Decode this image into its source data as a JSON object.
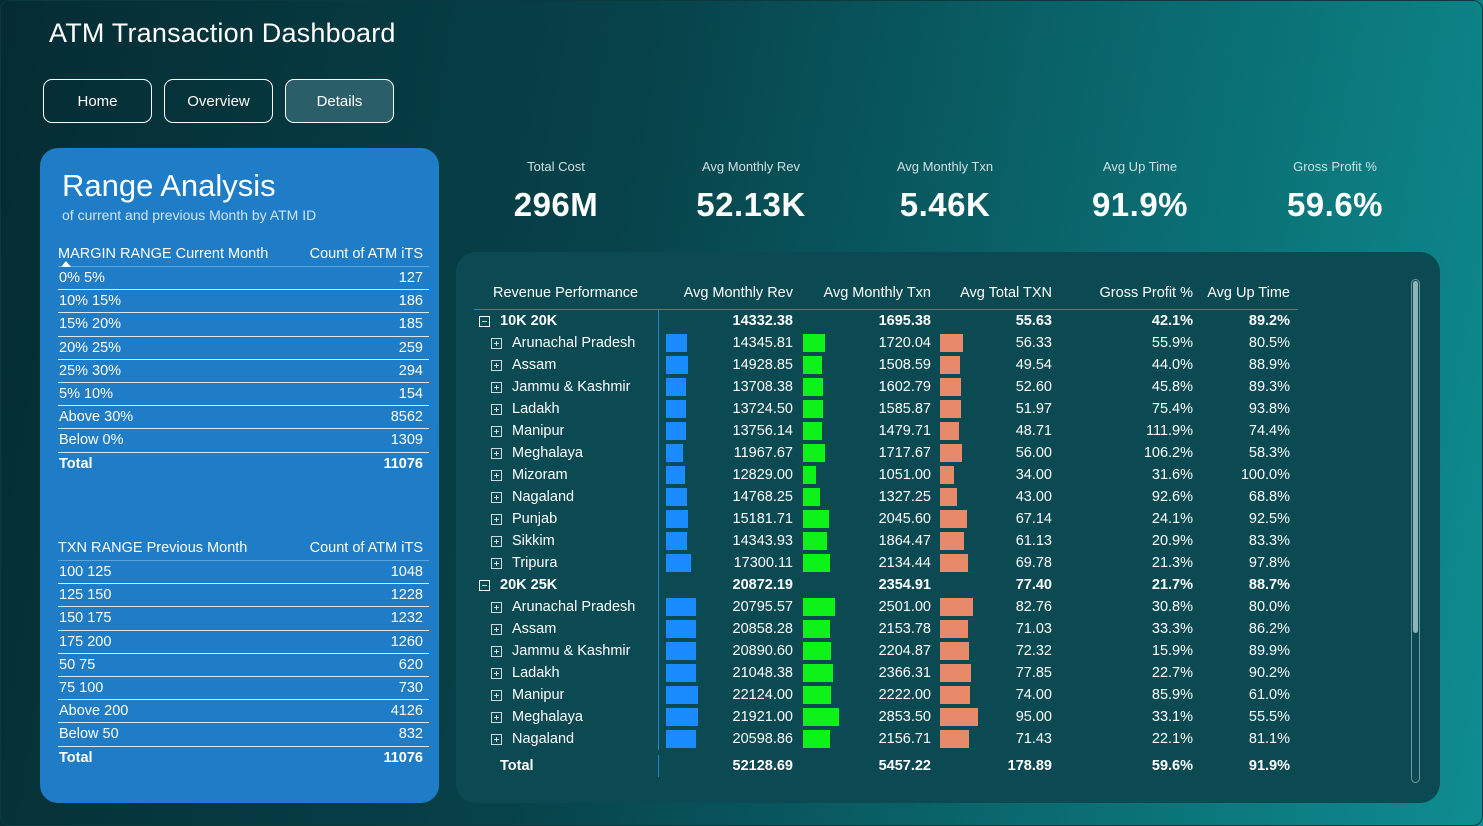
{
  "app": {
    "title": "ATM Transaction Dashboard"
  },
  "nav": [
    {
      "label": "Home",
      "active": false
    },
    {
      "label": "Overview",
      "active": false
    },
    {
      "label": "Details",
      "active": true
    }
  ],
  "range": {
    "title": "Range Analysis",
    "subtitle": "of current and previous Month by ATM ID",
    "margin": {
      "col1": "MARGIN RANGE Current Month",
      "col2": "Count of ATM iTS",
      "rows": [
        {
          "range": "0% 5%",
          "count": "127"
        },
        {
          "range": "10% 15%",
          "count": "186"
        },
        {
          "range": "15% 20%",
          "count": "185"
        },
        {
          "range": "20% 25%",
          "count": "259"
        },
        {
          "range": "25% 30%",
          "count": "294"
        },
        {
          "range": "5% 10%",
          "count": "154"
        },
        {
          "range": "Above 30%",
          "count": "8562"
        },
        {
          "range": "Below 0%",
          "count": "1309"
        }
      ],
      "total_label": "Total",
      "total": "11076"
    },
    "txn": {
      "col1": "TXN RANGE Previous Month",
      "col2": "Count of ATM iTS",
      "rows": [
        {
          "range": "100 125",
          "count": "1048"
        },
        {
          "range": "125 150",
          "count": "1228"
        },
        {
          "range": "150 175",
          "count": "1232"
        },
        {
          "range": "175 200",
          "count": "1260"
        },
        {
          "range": "50 75",
          "count": "620"
        },
        {
          "range": "75 100",
          "count": "730"
        },
        {
          "range": "Above 200",
          "count": "4126"
        },
        {
          "range": "Below 50",
          "count": "832"
        }
      ],
      "total_label": "Total",
      "total": "11076"
    }
  },
  "kpis": [
    {
      "label": "Total Cost",
      "value": "296M"
    },
    {
      "label": "Avg Monthly Rev",
      "value": "52.13K"
    },
    {
      "label": "Avg Monthly Txn",
      "value": "5.46K"
    },
    {
      "label": "Avg Up Time",
      "value": "91.9%"
    },
    {
      "label": "Gross Profit %",
      "value": "59.6%"
    }
  ],
  "matrix": {
    "headers": [
      "Revenue Performance",
      "Avg Monthly Rev",
      "Avg Monthly Txn",
      "Avg Total TXN",
      "Gross Profit %",
      "Avg Up Time"
    ],
    "bar_scale": {
      "rev_max": 22124.0,
      "txn_max": 2853.5,
      "tot_max": 95.0
    },
    "groups": [
      {
        "name": "10K 20K",
        "rev": "14332.38",
        "txn": "1695.38",
        "tot": "55.63",
        "gp": "42.1%",
        "up": "89.2%",
        "children": [
          {
            "name": "Arunachal Pradesh",
            "rev": "14345.81",
            "txn": "1720.04",
            "tot": "56.33",
            "gp": "55.9%",
            "up": "80.5%"
          },
          {
            "name": "Assam",
            "rev": "14928.85",
            "txn": "1508.59",
            "tot": "49.54",
            "gp": "44.0%",
            "up": "88.9%"
          },
          {
            "name": "Jammu & Kashmir",
            "rev": "13708.38",
            "txn": "1602.79",
            "tot": "52.60",
            "gp": "45.8%",
            "up": "89.3%"
          },
          {
            "name": "Ladakh",
            "rev": "13724.50",
            "txn": "1585.87",
            "tot": "51.97",
            "gp": "75.4%",
            "up": "93.8%"
          },
          {
            "name": "Manipur",
            "rev": "13756.14",
            "txn": "1479.71",
            "tot": "48.71",
            "gp": "111.9%",
            "up": "74.4%"
          },
          {
            "name": "Meghalaya",
            "rev": "11967.67",
            "txn": "1717.67",
            "tot": "56.00",
            "gp": "106.2%",
            "up": "58.3%"
          },
          {
            "name": "Mizoram",
            "rev": "12829.00",
            "txn": "1051.00",
            "tot": "34.00",
            "gp": "31.6%",
            "up": "100.0%"
          },
          {
            "name": "Nagaland",
            "rev": "14768.25",
            "txn": "1327.25",
            "tot": "43.00",
            "gp": "92.6%",
            "up": "68.8%"
          },
          {
            "name": "Punjab",
            "rev": "15181.71",
            "txn": "2045.60",
            "tot": "67.14",
            "gp": "24.1%",
            "up": "92.5%"
          },
          {
            "name": "Sikkim",
            "rev": "14343.93",
            "txn": "1864.47",
            "tot": "61.13",
            "gp": "20.9%",
            "up": "83.3%"
          },
          {
            "name": "Tripura",
            "rev": "17300.11",
            "txn": "2134.44",
            "tot": "69.78",
            "gp": "21.3%",
            "up": "97.8%"
          }
        ]
      },
      {
        "name": "20K 25K",
        "rev": "20872.19",
        "txn": "2354.91",
        "tot": "77.40",
        "gp": "21.7%",
        "up": "88.7%",
        "children": [
          {
            "name": "Arunachal Pradesh",
            "rev": "20795.57",
            "txn": "2501.00",
            "tot": "82.76",
            "gp": "30.8%",
            "up": "80.0%"
          },
          {
            "name": "Assam",
            "rev": "20858.28",
            "txn": "2153.78",
            "tot": "71.03",
            "gp": "33.3%",
            "up": "86.2%"
          },
          {
            "name": "Jammu & Kashmir",
            "rev": "20890.60",
            "txn": "2204.87",
            "tot": "72.32",
            "gp": "15.9%",
            "up": "89.9%"
          },
          {
            "name": "Ladakh",
            "rev": "21048.38",
            "txn": "2366.31",
            "tot": "77.85",
            "gp": "22.7%",
            "up": "90.2%"
          },
          {
            "name": "Manipur",
            "rev": "22124.00",
            "txn": "2222.00",
            "tot": "74.00",
            "gp": "85.9%",
            "up": "61.0%"
          },
          {
            "name": "Meghalaya",
            "rev": "21921.00",
            "txn": "2853.50",
            "tot": "95.00",
            "gp": "33.1%",
            "up": "55.5%"
          },
          {
            "name": "Nagaland",
            "rev": "20598.86",
            "txn": "2156.71",
            "tot": "71.43",
            "gp": "22.1%",
            "up": "81.1%"
          }
        ]
      }
    ],
    "total": {
      "name": "Total",
      "rev": "52128.69",
      "txn": "5457.22",
      "tot": "178.89",
      "gp": "59.6%",
      "up": "91.9%"
    }
  }
}
